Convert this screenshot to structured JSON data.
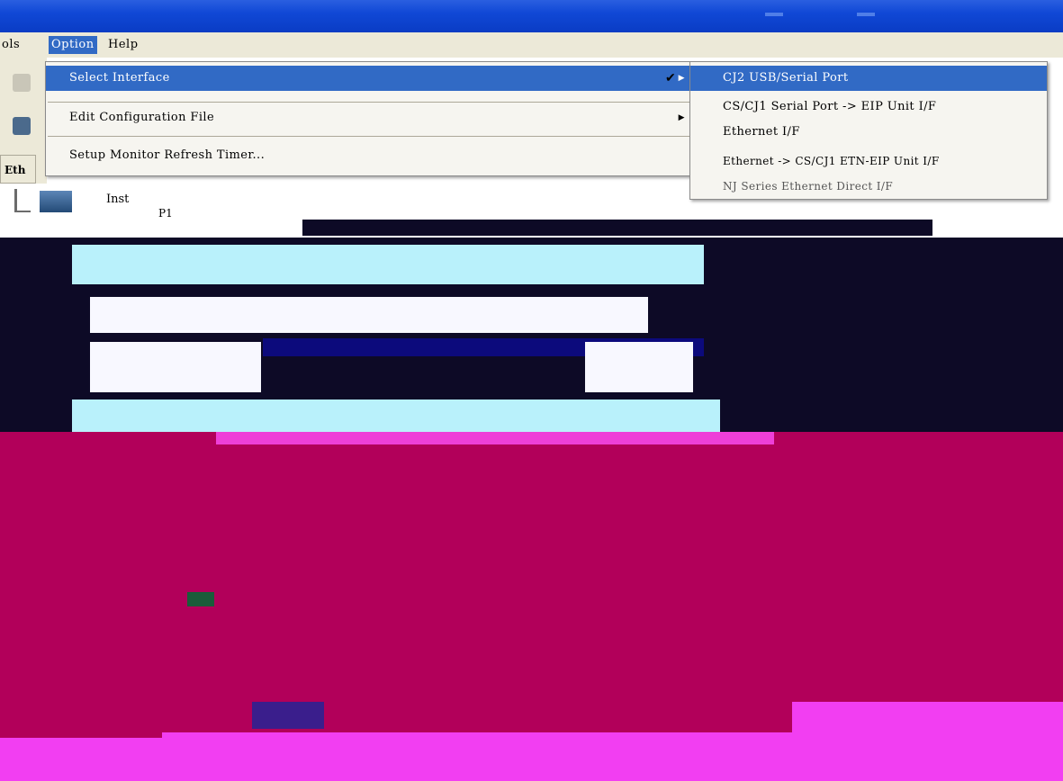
{
  "menubar": {
    "items": [
      {
        "label": "ols"
      },
      {
        "label": "Option"
      },
      {
        "label": "Help"
      }
    ]
  },
  "option_menu": {
    "items": [
      {
        "label": "Select Interface",
        "has_submenu": true,
        "highlighted": true
      },
      {
        "label": "Edit Configuration File",
        "has_submenu": true
      },
      {
        "label": "Setup Monitor Refresh Timer..."
      }
    ]
  },
  "interface_submenu": {
    "items": [
      {
        "label": "CJ2 USB/Serial Port",
        "checked": true,
        "highlighted": true
      },
      {
        "label": "CS/CJ1 Serial Port -> EIP Unit I/F"
      },
      {
        "label": "Ethernet I/F"
      },
      {
        "label": "Ethernet -> CS/CJ1 ETN-EIP Unit I/F"
      },
      {
        "label": "NJ Series Ethernet Direct I/F"
      }
    ]
  },
  "background": {
    "tab_label": "Eth",
    "install_label": "Inst",
    "p1_label": "P1"
  },
  "colors": {
    "titlebar": "#0a3cc4",
    "menubar": "#ece9d8",
    "highlight": "#316ac5",
    "dark_navy": "#0d0a26",
    "light_cyan": "#b9f1fb",
    "magenta_crimson": "#b2005a",
    "pink": "#f23ef2"
  }
}
